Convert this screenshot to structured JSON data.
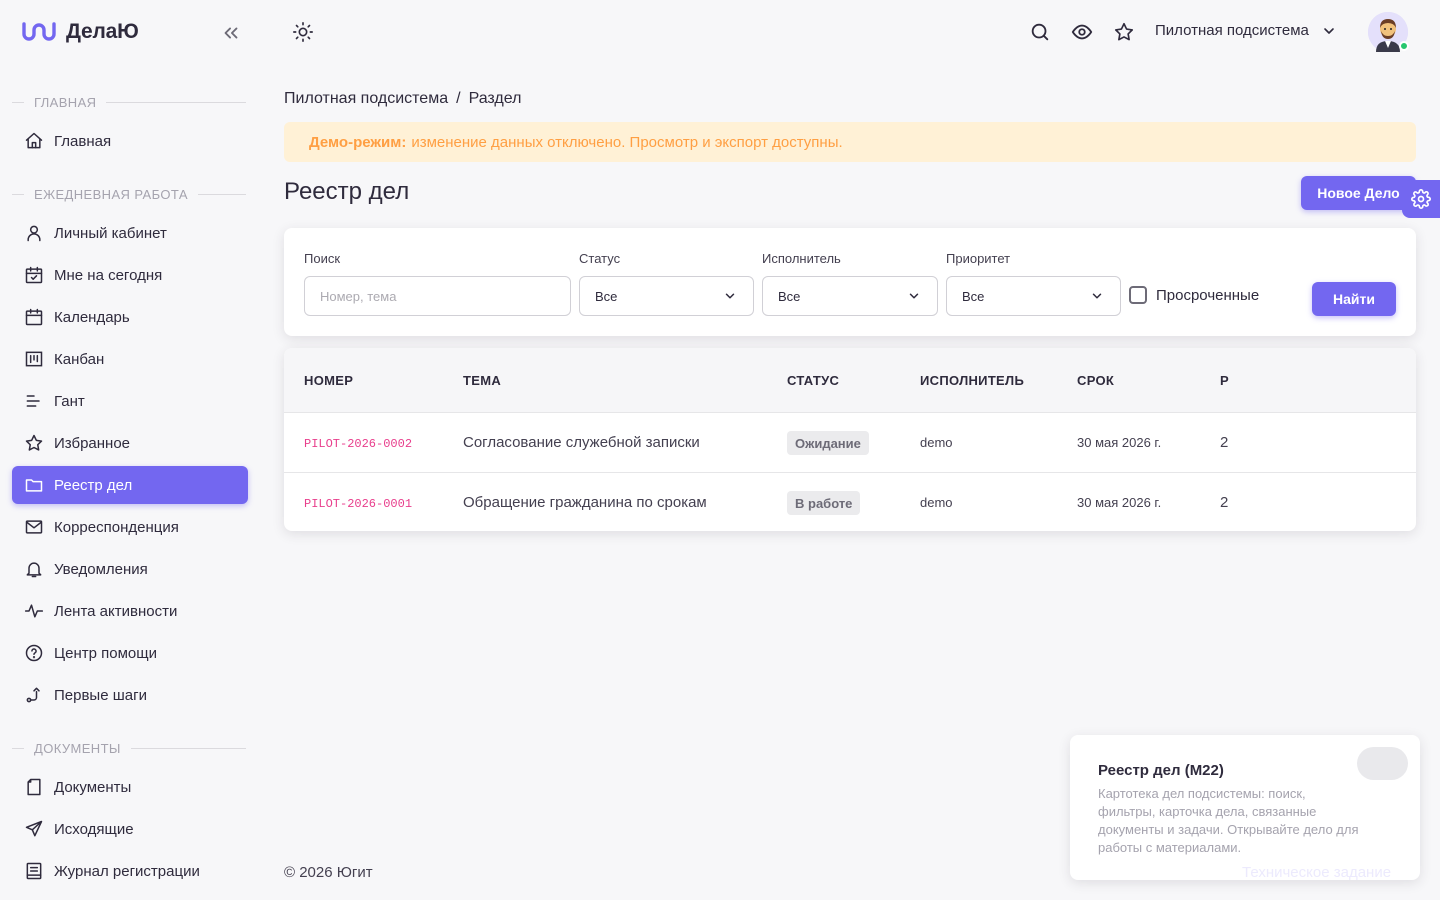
{
  "brand": {
    "name": "ДелаЮ",
    "accent": "#7367f0"
  },
  "sidebar": {
    "sections": [
      {
        "title": "ГЛАВНАЯ"
      },
      {
        "title": "ЕЖЕДНЕВНАЯ РАБОТА"
      },
      {
        "title": "ДОКУМЕНТЫ"
      }
    ],
    "items": [
      {
        "label": "Главная",
        "icon": "home-icon"
      },
      {
        "label": "Личный кабинет",
        "icon": "user-icon"
      },
      {
        "label": "Мне на сегодня",
        "icon": "calendar-check-icon"
      },
      {
        "label": "Календарь",
        "icon": "calendar-icon"
      },
      {
        "label": "Канбан",
        "icon": "kanban-icon"
      },
      {
        "label": "Гант",
        "icon": "gantt-icon"
      },
      {
        "label": "Избранное",
        "icon": "star-icon"
      },
      {
        "label": "Реестр дел",
        "icon": "folder-icon",
        "active": true
      },
      {
        "label": "Корреспонденция",
        "icon": "mail-icon"
      },
      {
        "label": "Уведомления",
        "icon": "bell-icon"
      },
      {
        "label": "Лента активности",
        "icon": "activity-icon"
      },
      {
        "label": "Центр помощи",
        "icon": "help-icon"
      },
      {
        "label": "Первые шаги",
        "icon": "route-icon"
      },
      {
        "label": "Документы",
        "icon": "file-icon"
      },
      {
        "label": "Исходящие",
        "icon": "send-icon"
      },
      {
        "label": "Журнал регистрации",
        "icon": "journal-icon"
      }
    ]
  },
  "topbar": {
    "subsystem": "Пилотная подсистема"
  },
  "breadcrumb": {
    "parent": "Пилотная подсистема",
    "separator": "/",
    "current": "Раздел"
  },
  "alert": {
    "bold": "Демо-режим:",
    "text": "изменение данных отключено. Просмотр и экспорт доступны."
  },
  "page": {
    "title": "Реестр дел",
    "new_button": "Новое Дело"
  },
  "filters": {
    "search_label": "Поиск",
    "search_placeholder": "Номер, тема",
    "status_label": "Статус",
    "status_value": "Все",
    "assignee_label": "Исполнитель",
    "assignee_value": "Все",
    "priority_label": "Приоритет",
    "priority_value": "Все",
    "overdue_label": "Просроченные",
    "find_button": "Найти"
  },
  "table": {
    "headers": [
      "НОМЕР",
      "ТЕМА",
      "СТАТУС",
      "ИСПОЛНИТЕЛЬ",
      "СРОК",
      "Р"
    ],
    "rows": [
      {
        "number": "PILOT-2026-0002",
        "subject": "Согласование служебной записки",
        "status": "Ожидание",
        "assignee": "demo",
        "due": "30 мая 2026 г.",
        "priority": "2"
      },
      {
        "number": "PILOT-2026-0001",
        "subject": "Обращение гражданина по срокам",
        "status": "В работе",
        "assignee": "demo",
        "due": "30 мая 2026 г.",
        "priority": "2"
      }
    ]
  },
  "footer": {
    "copyright": "© 2026 Югит"
  },
  "info_card": {
    "title": "Реестр дел (М22)",
    "text": "Картотека дел подсистемы: поиск, фильтры, карточка дела, связанные документы и задачи. Открывайте дело для работы с материалами.",
    "link": "Техническое задание"
  }
}
